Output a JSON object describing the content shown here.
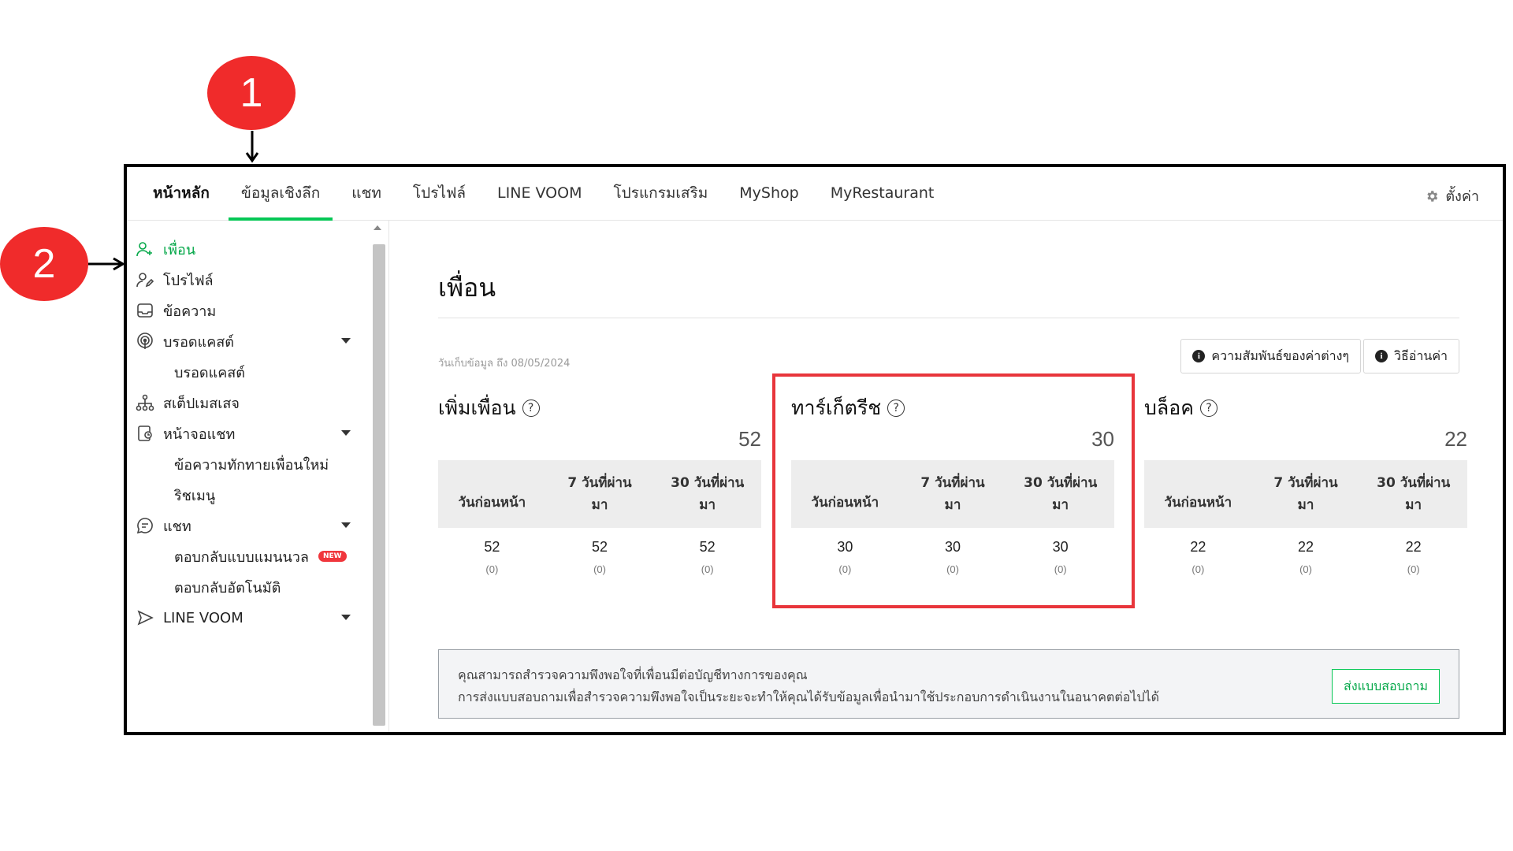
{
  "callouts": {
    "one": "1",
    "two": "2"
  },
  "colors": {
    "accent": "#06c755",
    "callout": "#f02b2b",
    "highlight": "#e8353b"
  },
  "nav": {
    "tabs": [
      {
        "label": "หน้าหลัก"
      },
      {
        "label": "ข้อมูลเชิงลึก"
      },
      {
        "label": "แชท"
      },
      {
        "label": "โปรไฟล์"
      },
      {
        "label": "LINE VOOM"
      },
      {
        "label": "โปรแกรมเสริม"
      },
      {
        "label": "MyShop"
      },
      {
        "label": "MyRestaurant"
      }
    ],
    "settings_label": "ตั้งค่า",
    "settings_icon": "gear-icon"
  },
  "sidebar": {
    "items": [
      {
        "label": "เพื่อน",
        "icon": "friend-add-icon"
      },
      {
        "label": "โปรไฟล์",
        "icon": "profile-icon"
      },
      {
        "label": "ข้อความ",
        "icon": "inbox-icon"
      },
      {
        "label": "บรอดแคสต์",
        "icon": "broadcast-icon"
      },
      {
        "label": "บรอดแคสต์"
      },
      {
        "label": "สเต็ปเมสเสจ",
        "icon": "step-message-icon"
      },
      {
        "label": "หน้าจอแชท",
        "icon": "chat-screen-icon"
      },
      {
        "label": "ข้อความทักทายเพื่อนใหม่"
      },
      {
        "label": "ริชเมนู"
      },
      {
        "label": "แชท",
        "icon": "chat-icon"
      },
      {
        "label": "ตอบกลับแบบแมนนวล",
        "badge": "NEW"
      },
      {
        "label": "ตอบกลับอัตโนมัติ"
      },
      {
        "label": "LINE VOOM",
        "icon": "voom-icon"
      }
    ]
  },
  "main": {
    "title": "เพื่อน",
    "date_note": "วันเก็บข้อมูล ถึง 08/05/2024",
    "btn_relation": "ความสัมพันธ์ของค่าต่างๆ",
    "btn_howto": "วิธีอ่านค่า",
    "stats": [
      {
        "title": "เพิ่มเพื่อน",
        "total": "52",
        "headers": [
          "วันก่อนหน้า",
          "7 วันที่ผ่าน",
          "มา",
          "30 วันที่ผ่าน",
          "มา"
        ],
        "values": [
          "52",
          "52",
          "52"
        ],
        "subs": [
          "(0)",
          "(0)",
          "(0)"
        ]
      },
      {
        "title": "ทาร์เก็ตรีช",
        "total": "30",
        "headers": [
          "วันก่อนหน้า",
          "7 วันที่ผ่าน",
          "มา",
          "30 วันที่ผ่าน",
          "มา"
        ],
        "values": [
          "30",
          "30",
          "30"
        ],
        "subs": [
          "(0)",
          "(0)",
          "(0)"
        ]
      },
      {
        "title": "บล็อค",
        "total": "22",
        "headers": [
          "วันก่อนหน้า",
          "7 วันที่ผ่าน",
          "มา",
          "30 วันที่ผ่าน",
          "มา"
        ],
        "values": [
          "22",
          "22",
          "22"
        ],
        "subs": [
          "(0)",
          "(0)",
          "(0)"
        ]
      }
    ],
    "survey": {
      "line1": "คุณสามารถสำรวจความพึงพอใจที่เพื่อนมีต่อบัญชีทางการของคุณ",
      "line2": "การส่งแบบสอบถามเพื่อสำรวจความพึงพอใจเป็นระยะจะทำให้คุณได้รับข้อมูลเพื่อนำมาใช้ประกอบการดำเนินงานในอนาคตต่อไปได้",
      "button": "ส่งแบบสอบถาม"
    }
  }
}
